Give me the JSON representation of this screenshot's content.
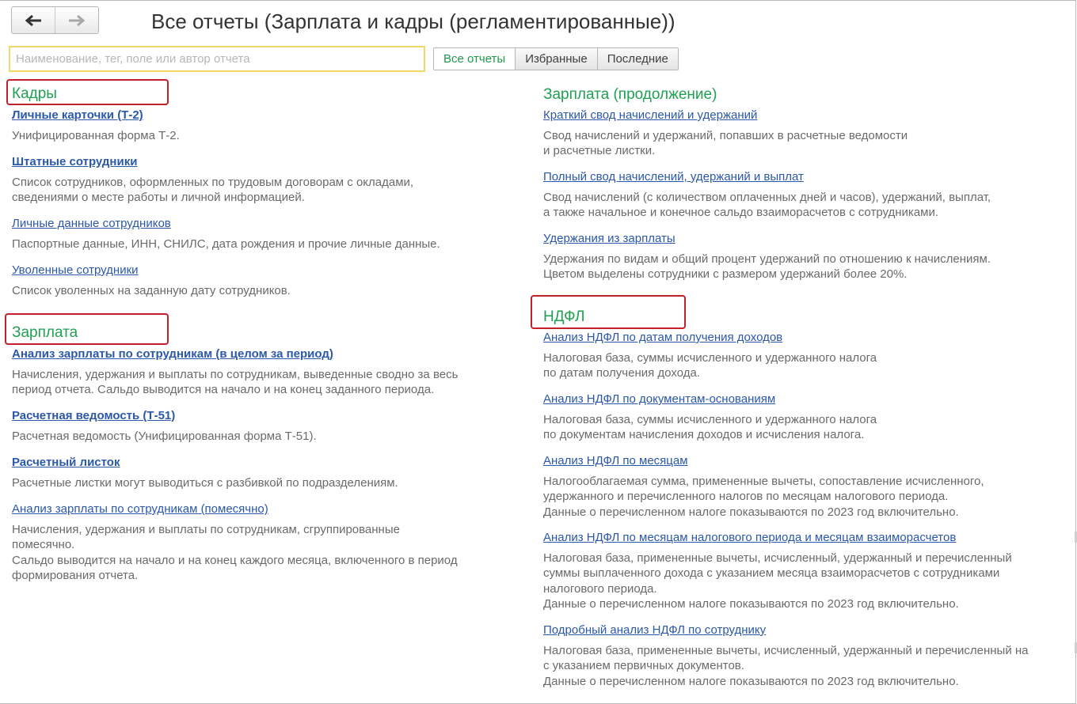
{
  "window": {
    "title": "Все отчеты (Зарплата и кадры (регламентированные))"
  },
  "nav": {
    "back_icon": "arrow-left-icon",
    "forward_icon": "arrow-right-icon"
  },
  "search": {
    "value": "",
    "placeholder": "Наименование, тег, поле или автор отчета"
  },
  "filters": [
    {
      "label": "Все отчеты",
      "active": true
    },
    {
      "label": "Избранные",
      "active": false
    },
    {
      "label": "Последние",
      "active": false
    }
  ],
  "colors": {
    "section": "#20a052",
    "link": "#2b58a8",
    "highlight_box": "#c3202c",
    "search_border": "#f2d76b"
  },
  "sections": {
    "kadry": {
      "title": "Кадры",
      "reports": [
        {
          "name": "Личные карточки (Т-2)",
          "bold": true,
          "desc": "Унифицированная форма Т-2."
        },
        {
          "name": "Штатные сотрудники",
          "bold": true,
          "desc": "Список сотрудников, оформленных по трудовым договорам с окладами,\nсведениями о месте работы и личной информацией."
        },
        {
          "name": "Личные данные сотрудников",
          "bold": false,
          "desc": "Паспортные данные, ИНН, СНИЛС, дата рождения и прочие личные данные."
        },
        {
          "name": "Уволенные сотрудники",
          "bold": false,
          "desc": "Список уволенных на заданную дату сотрудников."
        }
      ]
    },
    "zarplata": {
      "title": "Зарплата",
      "reports": [
        {
          "name": "Анализ зарплаты по сотрудникам (в целом за период)",
          "bold": true,
          "desc": "Начисления, удержания и выплаты по сотрудникам, выведенные сводно за весь\nпериод отчета. Сальдо выводится на начало и на конец заданного периода."
        },
        {
          "name": "Расчетная ведомость (Т-51)",
          "bold": true,
          "desc": "Расчетная ведомость (Унифицированная форма Т-51)."
        },
        {
          "name": "Расчетный листок",
          "bold": true,
          "desc": "Расчетные листки могут выводиться с разбивкой по подразделениям."
        },
        {
          "name": "Анализ зарплаты по сотрудникам (помесячно)",
          "bold": false,
          "desc": "Начисления, удержания и выплаты по сотрудникам, сгруппированные\nпомесячно.\nСальдо выводится на начало и на конец каждого месяца, включенного в период\nформирования отчета."
        }
      ]
    },
    "zarplata_cont": {
      "title": "Зарплата (продолжение)",
      "reports": [
        {
          "name": "Краткий свод начислений и удержаний",
          "bold": false,
          "desc": "Свод начислений и удержаний, попавших в расчетные ведомости\nи расчетные листки."
        },
        {
          "name": "Полный свод начислений, удержаний и выплат",
          "bold": false,
          "desc": "Свод начислений (с количеством оплаченных дней и часов), удержаний, выплат,\nа также начальное и конечное сальдо взаиморасчетов с сотрудниками."
        },
        {
          "name": "Удержания из зарплаты",
          "bold": false,
          "desc": "Удержания по видам и общий процент удержаний по отношению к начислениям.\nЦветом выделены сотрудники с размером удержаний более 20%."
        }
      ]
    },
    "ndfl": {
      "title": "НДФЛ",
      "reports": [
        {
          "name": "Анализ НДФЛ по датам получения доходов",
          "bold": false,
          "desc": "Налоговая база, суммы исчисленного и удержанного налога\nпо датам получения дохода."
        },
        {
          "name": "Анализ НДФЛ по документам-основаниям",
          "bold": false,
          "desc": "Налоговая база, суммы исчисленного и удержанного налога\nпо документам начисления доходов и исчисления налога."
        },
        {
          "name": "Анализ НДФЛ по месяцам",
          "bold": false,
          "desc": "Налогооблагаемая сумма, примененные вычеты, сопоставление исчисленного,\nудержанного и перечисленного налогов по месяцам налогового периода.\nДанные о перечисленном налоге показываются по 2023 год включительно."
        },
        {
          "name": "Анализ НДФЛ по месяцам налогового периода и месяцам взаиморасчетов",
          "bold": false,
          "desc": "Налоговая база, примененные вычеты, исчисленный, удержанный и перечисленный\nсуммы выплаченного дохода с указанием месяца взаиморасчетов с сотрудниками\nналогового периода.\nДанные о перечисленном налоге показываются по 2023 год включительно."
        },
        {
          "name": "Подробный анализ НДФЛ по сотруднику",
          "bold": false,
          "desc": "Налоговая база, примененные вычеты, исчисленный, удержанный и перечисленный на\nс указанием первичных документов.\nДанные о перечисленном налоге показываются по 2023 год включительно."
        }
      ]
    }
  }
}
